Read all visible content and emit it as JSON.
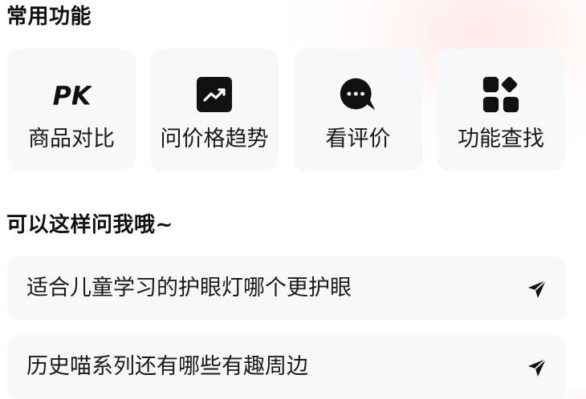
{
  "sections": {
    "common_functions_title": "常用功能",
    "ask_me_title": "可以这样问我哦~"
  },
  "features": [
    {
      "label": "商品对比",
      "icon": "pk-icon"
    },
    {
      "label": "问价格趋势",
      "icon": "trend-chart-icon"
    },
    {
      "label": "看评价",
      "icon": "chat-bubble-icon"
    },
    {
      "label": "功能查找",
      "icon": "grid-apps-icon"
    }
  ],
  "suggestions": [
    {
      "text": "适合儿童学习的护眼灯哪个更护眼",
      "icon": "send-icon"
    },
    {
      "text": "历史喵系列还有哪些有趣周边",
      "icon": "send-icon"
    }
  ],
  "colors": {
    "card_background": "#f6f8fa",
    "text": "#1a1a1a",
    "icon": "#111111",
    "accent_glow": "#ffd6d6"
  }
}
